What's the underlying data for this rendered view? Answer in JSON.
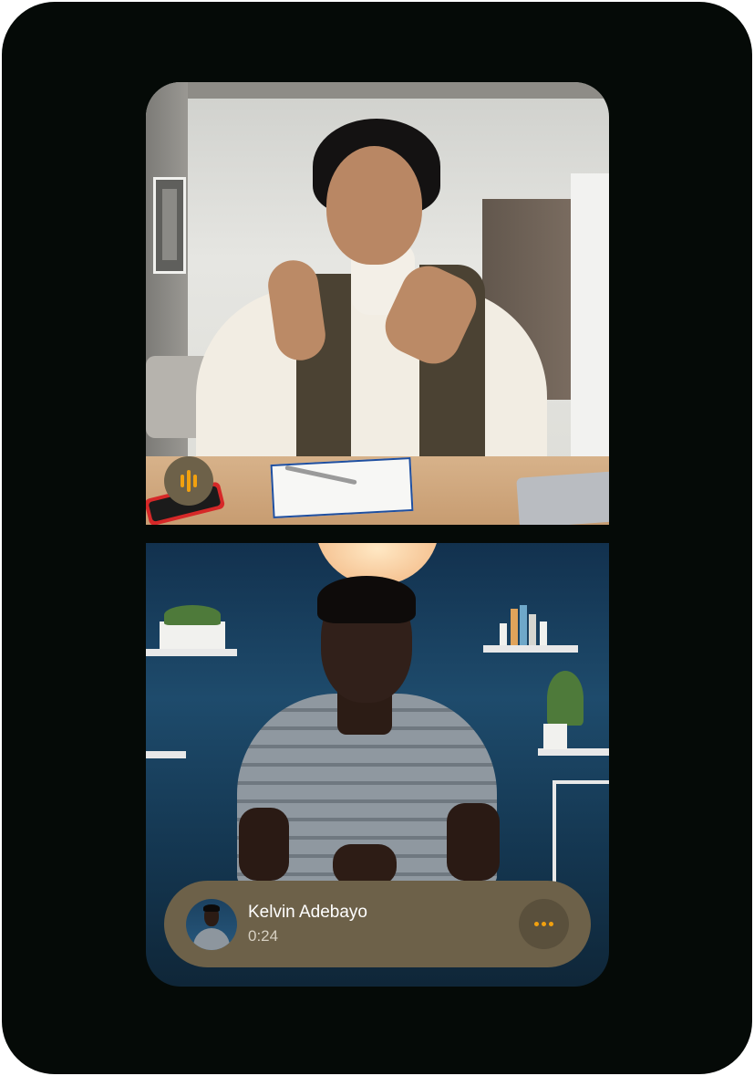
{
  "call": {
    "caller_name": "Kelvin Adebayo",
    "duration": "0:24"
  },
  "controls": {
    "audio_indicator_icon": "audio-waveform-icon",
    "more_icon": "more-horizontal-icon"
  },
  "colors": {
    "background": "#050a07",
    "bar": "#6d6149",
    "accent": "#f2a10f",
    "text_primary": "#ffffff"
  }
}
